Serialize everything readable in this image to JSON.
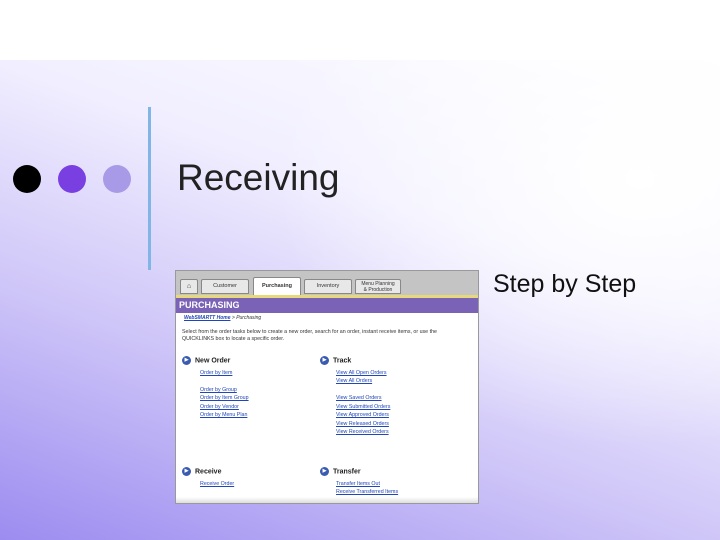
{
  "slide": {
    "title": "Receiving",
    "subtitle": "Step by Step"
  },
  "screenshot": {
    "tabs": {
      "home_icon": "⌂",
      "customer": "Customer",
      "purchasing": "Purchasing",
      "inventory": "Inventory",
      "menu_line1": "Menu Planning",
      "menu_line2": "& Production"
    },
    "header": "PURCHASING",
    "breadcrumb": {
      "home": "WebSMARTT Home",
      "separator": " > ",
      "current": "Purchasing"
    },
    "intro": "Select from the order tasks below to create a new order, search for an order, instant receive items, or use the QUICKLINKS box to locate a specific order.",
    "sections": {
      "new_order": {
        "title": "New Order",
        "links": [
          "Order by Item",
          "Order by Group",
          "Order by Item Group",
          "Order by Vendor",
          "Order by Menu Plan"
        ]
      },
      "track": {
        "title": "Track",
        "links": [
          "View All Open Orders",
          "View All Orders",
          "View Saved Orders",
          "View Submitted Orders",
          "View Approved Orders",
          "View Released Orders",
          "View Received Orders"
        ]
      },
      "receive": {
        "title": "Receive",
        "links": [
          "Receive Order"
        ]
      },
      "transfer": {
        "title": "Transfer",
        "links": [
          "Transfer Items Out",
          "Receive Transferred Items"
        ]
      }
    },
    "bullet_glyph": "▶"
  },
  "colors": {
    "header_purple": "#7a62b6",
    "link_blue": "#2046b8",
    "dot_black": "#000000",
    "dot_purple": "#7a3fe0",
    "dot_lavender": "#a99ae8",
    "accent_line": "#7fb6e6"
  }
}
